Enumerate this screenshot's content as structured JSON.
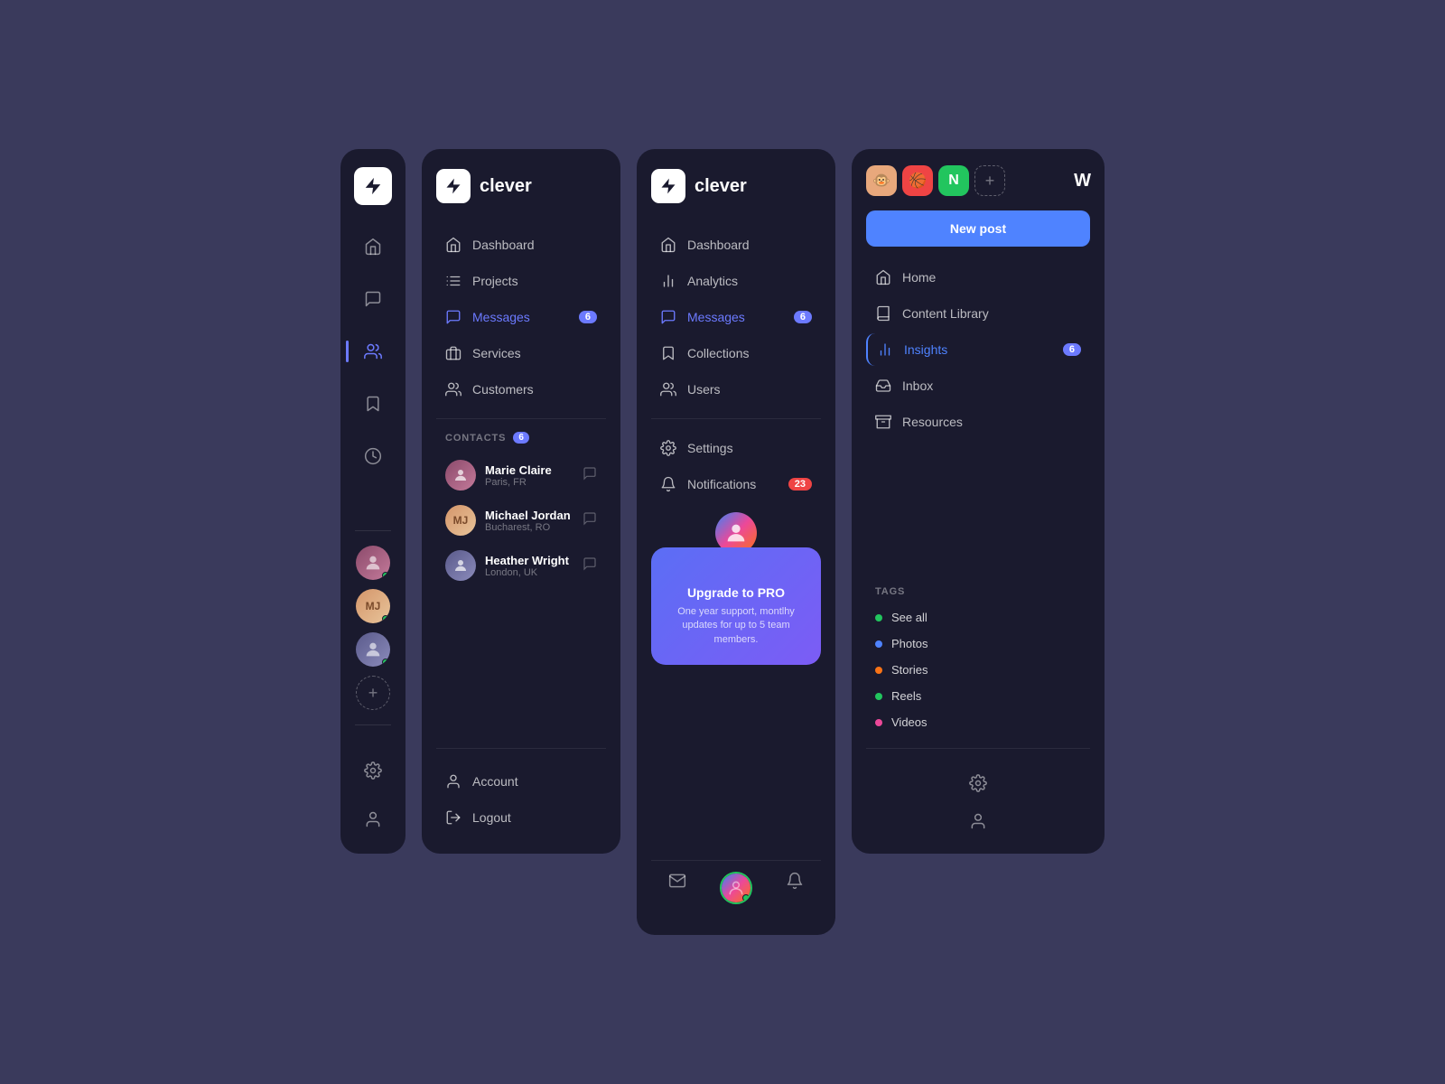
{
  "bg_color": "#3a3a5c",
  "panel1": {
    "logo": "⚡",
    "nav_items": [
      {
        "icon": "home",
        "label": "Home",
        "active": false
      },
      {
        "icon": "message",
        "label": "Messages",
        "active": false
      },
      {
        "icon": "users",
        "label": "Users",
        "active": true
      },
      {
        "icon": "bookmark",
        "label": "Bookmarks",
        "active": false
      },
      {
        "icon": "clock",
        "label": "History",
        "active": false
      }
    ],
    "contacts": [
      {
        "initials": "",
        "color": "#8b4a6b",
        "online": true,
        "type": "photo"
      },
      {
        "initials": "MJ",
        "color": "#e8a87c",
        "online": true,
        "type": "initials"
      },
      {
        "initials": "",
        "color": "#6b8b4a",
        "online": true,
        "type": "photo"
      },
      {
        "initials": "+",
        "color": "transparent",
        "online": false,
        "type": "add"
      }
    ],
    "bottom_items": [
      {
        "icon": "settings",
        "label": "Settings"
      },
      {
        "icon": "user",
        "label": "Profile"
      }
    ]
  },
  "panel2": {
    "brand": "clever",
    "nav_items": [
      {
        "icon": "home",
        "label": "Dashboard",
        "active": false,
        "badge": null
      },
      {
        "icon": "grid",
        "label": "Projects",
        "active": false,
        "badge": null
      },
      {
        "icon": "message-circle",
        "label": "Messages",
        "active": true,
        "badge": "6"
      },
      {
        "icon": "briefcase",
        "label": "Services",
        "active": false,
        "badge": null
      },
      {
        "icon": "users",
        "label": "Customers",
        "active": false,
        "badge": null
      }
    ],
    "contacts_label": "CONTACTS",
    "contacts_badge": "6",
    "contacts": [
      {
        "name": "Marie Claire",
        "location": "Paris, FR",
        "avatar_type": "photo",
        "color": "#8b4a6b"
      },
      {
        "name": "Michael Jordan",
        "location": "Bucharest, RO",
        "avatar_type": "initials",
        "initials": "MJ",
        "color": "#e8a87c"
      },
      {
        "name": "Heather Wright",
        "location": "London, UK",
        "avatar_type": "photo",
        "color": "#6b5b8b"
      }
    ],
    "bottom_nav": [
      {
        "icon": "user",
        "label": "Account"
      },
      {
        "icon": "log-out",
        "label": "Logout"
      }
    ]
  },
  "panel3": {
    "brand": "clever",
    "nav_items": [
      {
        "icon": "home",
        "label": "Dashboard",
        "active": false,
        "badge": null
      },
      {
        "icon": "bar-chart",
        "label": "Analytics",
        "active": false,
        "badge": null
      },
      {
        "icon": "message-circle",
        "label": "Messages",
        "active": true,
        "badge": "6"
      },
      {
        "icon": "bookmark",
        "label": "Collections",
        "active": false,
        "badge": null
      },
      {
        "icon": "users",
        "label": "Users",
        "active": false,
        "badge": null
      }
    ],
    "bottom_nav_items": [
      {
        "icon": "settings",
        "label": "Settings",
        "badge": null
      },
      {
        "icon": "bell",
        "label": "Notifications",
        "badge": "23"
      }
    ],
    "upgrade_card": {
      "title": "Upgrade to PRO",
      "description": "One year support, montlhy updates for up to 5 team members."
    },
    "bottom_tabs": [
      {
        "icon": "mail",
        "label": "Email"
      },
      {
        "icon": "user-circle",
        "label": "Profile"
      },
      {
        "icon": "bell",
        "label": "Notifications"
      }
    ]
  },
  "panel4": {
    "new_post_label": "New post",
    "logo": "W",
    "social_apps": [
      {
        "icon": "🐵",
        "color": "#e8a87c",
        "label": "Mailchimp"
      },
      {
        "icon": "🏀",
        "color": "#ef4444",
        "label": "Dribbble"
      },
      {
        "icon": "N",
        "color": "#22c55e",
        "label": "Notion"
      }
    ],
    "nav_items": [
      {
        "icon": "home",
        "label": "Home",
        "active": false,
        "badge": null
      },
      {
        "icon": "library",
        "label": "Content Library",
        "active": false,
        "badge": null
      },
      {
        "icon": "bar-chart",
        "label": "Insights",
        "active": true,
        "badge": "6"
      },
      {
        "icon": "inbox",
        "label": "Inbox",
        "active": false,
        "badge": null
      },
      {
        "icon": "archive",
        "label": "Resources",
        "active": false,
        "badge": null
      }
    ],
    "tags_label": "TAGS",
    "tags": [
      {
        "label": "See all",
        "color": "#22c55e"
      },
      {
        "label": "Photos",
        "color": "#4f83ff"
      },
      {
        "label": "Stories",
        "color": "#f97316"
      },
      {
        "label": "Reels",
        "color": "#22c55e"
      },
      {
        "label": "Videos",
        "color": "#ec4899"
      }
    ],
    "bottom_items": [
      {
        "icon": "settings",
        "label": "Settings"
      },
      {
        "icon": "user",
        "label": "Profile"
      }
    ]
  }
}
